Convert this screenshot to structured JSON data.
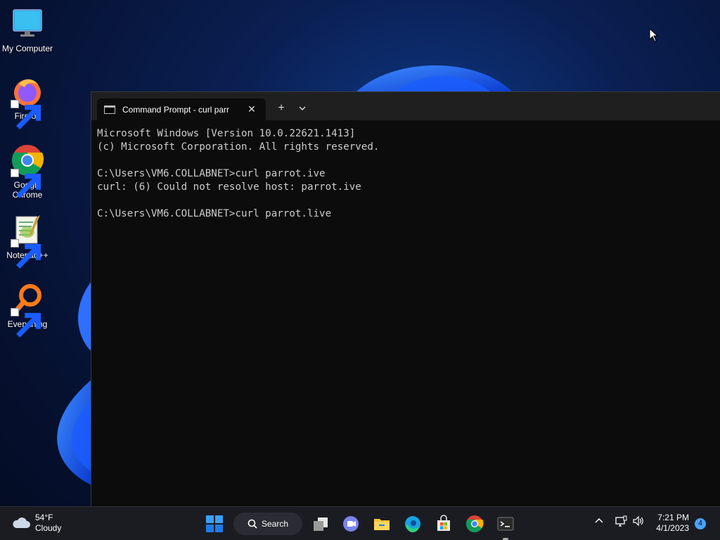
{
  "desktop": {
    "icons": [
      {
        "label": "My Computer",
        "icon": "monitor-icon"
      },
      {
        "label": "Firefox",
        "icon": "firefox-icon"
      },
      {
        "label": "Google Chrome",
        "icon": "chrome-icon"
      },
      {
        "label": "Notepad++",
        "icon": "notepadpp-icon"
      },
      {
        "label": "Everything",
        "icon": "everything-icon"
      }
    ]
  },
  "terminal": {
    "tab_title": "Command Prompt - curl  parr",
    "new_tab_symbol": "+",
    "dropdown_symbol": "⌄",
    "close_symbol": "✕",
    "lines": [
      "Microsoft Windows [Version 10.0.22621.1413]",
      "(c) Microsoft Corporation. All rights reserved.",
      "",
      "C:\\Users\\VM6.COLLABNET>curl parrot.ive",
      "curl: (6) Could not resolve host: parrot.ive",
      "",
      "C:\\Users\\VM6.COLLABNET>curl parrot.live"
    ]
  },
  "taskbar": {
    "weather": {
      "temp": "54°F",
      "condition": "Cloudy"
    },
    "search_label": "Search",
    "apps": [
      "start-icon",
      "task-view-icon",
      "teams-chat-icon",
      "file-explorer-icon",
      "edge-icon",
      "store-icon",
      "chrome-icon",
      "terminal-icon"
    ],
    "clock": {
      "time": "7:21 PM",
      "date": "4/1/2023"
    },
    "notification_count": "4"
  }
}
